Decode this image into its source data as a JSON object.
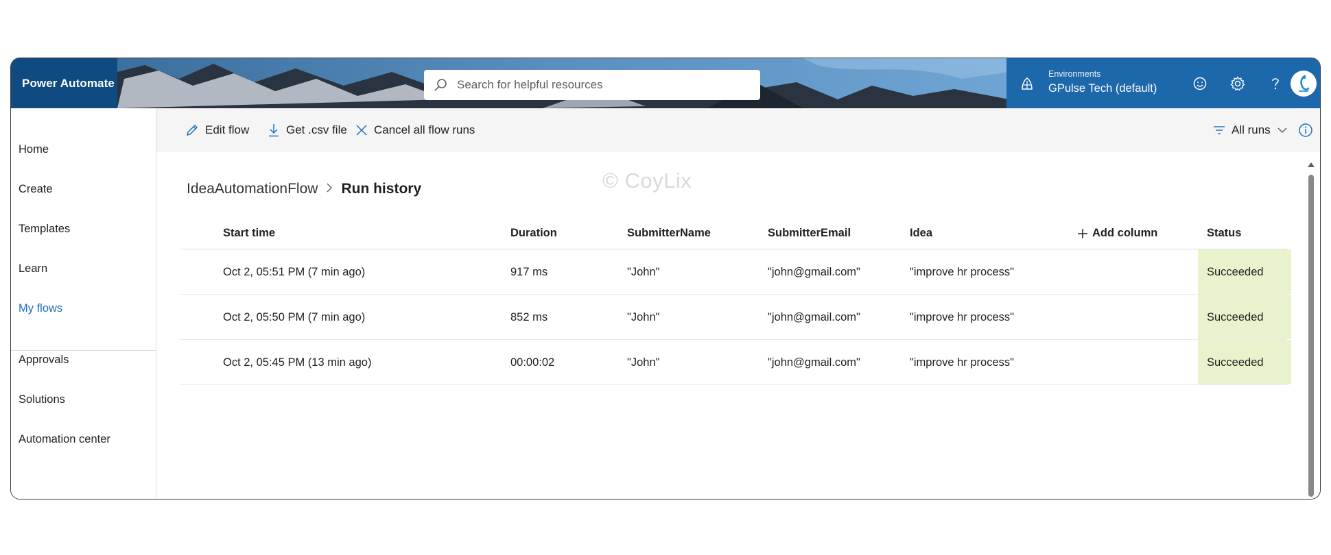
{
  "app": {
    "title": "Power Automate"
  },
  "search": {
    "placeholder": "Search for helpful resources"
  },
  "environment": {
    "label": "Environments",
    "name": "GPulse Tech (default)"
  },
  "header_icons": [
    "environment-icon",
    "smiley-icon",
    "gear-icon",
    "help-icon",
    "avatar"
  ],
  "sidebar": {
    "items": [
      {
        "label": "Home"
      },
      {
        "label": "Create"
      },
      {
        "label": "Templates"
      },
      {
        "label": "Learn"
      },
      {
        "label": "My flows",
        "active": true
      },
      {
        "label": "Approvals"
      },
      {
        "label": "Solutions"
      },
      {
        "label": "Automation center"
      }
    ]
  },
  "commands": {
    "edit_flow": "Edit flow",
    "get_csv": "Get .csv file",
    "cancel_runs": "Cancel all flow runs",
    "filter": "All runs"
  },
  "breadcrumb": {
    "parent": "IdeaAutomationFlow",
    "current": "Run history"
  },
  "watermark": "© CoyLix",
  "table": {
    "columns": {
      "start_time": "Start time",
      "duration": "Duration",
      "submitter_name": "SubmitterName",
      "submitter_email": "SubmitterEmail",
      "idea": "Idea",
      "add_column": "Add column",
      "status": "Status"
    },
    "rows": [
      {
        "start_time": "Oct 2, 05:51 PM (7 min ago)",
        "duration": "917 ms",
        "submitter_name": "\"John\"",
        "submitter_email": "\"john@gmail.com\"",
        "idea": "\"improve hr process\"",
        "status": "Succeeded"
      },
      {
        "start_time": "Oct 2, 05:50 PM (7 min ago)",
        "duration": "852 ms",
        "submitter_name": "\"John\"",
        "submitter_email": "\"john@gmail.com\"",
        "idea": "\"improve hr process\"",
        "status": "Succeeded"
      },
      {
        "start_time": "Oct 2, 05:45 PM (13 min ago)",
        "duration": "00:00:02",
        "submitter_name": "\"John\"",
        "submitter_email": "\"john@gmail.com\"",
        "idea": "\"improve hr process\"",
        "status": "Succeeded"
      }
    ]
  },
  "colors": {
    "brand": "#0f4a80",
    "accent": "#1b6ec2",
    "status_success_bg": "#e8f2cc"
  }
}
